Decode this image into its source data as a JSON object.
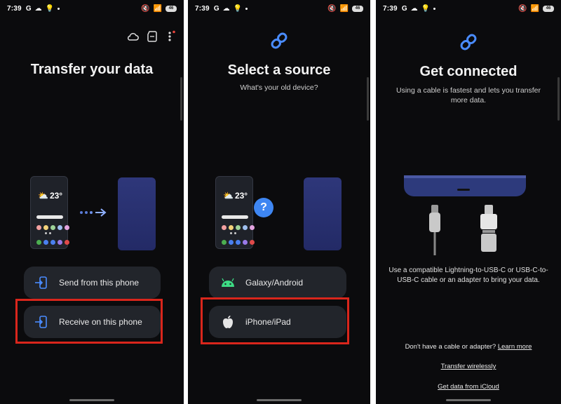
{
  "status_bar": {
    "time": "7:39",
    "carrier": "G",
    "battery": "46"
  },
  "screen1": {
    "title": "Transfer your data",
    "weather_temp": "23°",
    "options": [
      {
        "label": "Send from this phone",
        "icon": "send-phone-icon"
      },
      {
        "label": "Receive on this phone",
        "icon": "receive-phone-icon"
      }
    ],
    "header_icons": [
      "cloud-icon",
      "sd-card-icon",
      "more-vert-icon"
    ]
  },
  "screen2": {
    "title": "Select a source",
    "subtitle": "What's your old device?",
    "weather_temp": "23°",
    "question_mark": "?",
    "options": [
      {
        "label": "Galaxy/Android",
        "icon": "android-icon"
      },
      {
        "label": "iPhone/iPad",
        "icon": "apple-icon"
      }
    ]
  },
  "screen3": {
    "title": "Get connected",
    "subtitle": "Using a cable is fastest and lets you transfer more data.",
    "instructions": "Use a compatible Lightning-to-USB-C or USB-C-to-USB-C cable or an adapter to bring your data.",
    "no_cable_text": "Don't have a cable or adapter?",
    "learn_more": "Learn more",
    "transfer_wirelessly": "Transfer wirelessly",
    "get_icloud": "Get data from iCloud"
  },
  "colors": {
    "highlight": "#d9261c",
    "link_blue": "#3b8bff",
    "accent_blue": "#4a8cff"
  }
}
